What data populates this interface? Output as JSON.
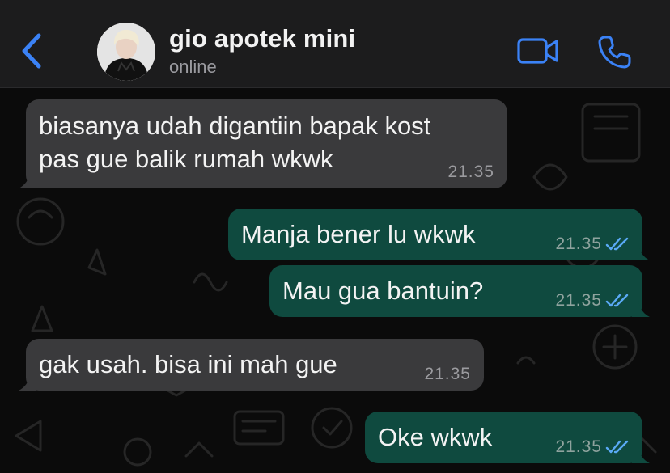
{
  "header": {
    "back_icon": "chevron-left-icon",
    "contact_name": "gio apotek mini",
    "contact_status": "online",
    "video_icon": "video-camera-icon",
    "call_icon": "phone-icon",
    "accent_color": "#3b82f6"
  },
  "messages": [
    {
      "direction": "incoming",
      "lines": [
        "biasanya udah digantiin bapak kost",
        "pas gue balik rumah wkwk"
      ],
      "time": "21.35"
    },
    {
      "direction": "outgoing",
      "lines": [
        "Manja bener lu wkwk"
      ],
      "time": "21.35",
      "status_icon": "double-check-icon"
    },
    {
      "direction": "outgoing",
      "lines": [
        "Mau gua bantuin?"
      ],
      "time": "21.35",
      "status_icon": "double-check-icon"
    },
    {
      "direction": "incoming",
      "lines": [
        "gak usah. bisa ini mah gue"
      ],
      "time": "21.35"
    },
    {
      "direction": "outgoing",
      "lines": [
        "Oke wkwk"
      ],
      "time": "21.35",
      "status_icon": "double-check-icon"
    }
  ],
  "colors": {
    "incoming_bubble": "#3a3a3c",
    "outgoing_bubble": "#0f4a3f",
    "read_ticks": "#5aa9f5"
  }
}
